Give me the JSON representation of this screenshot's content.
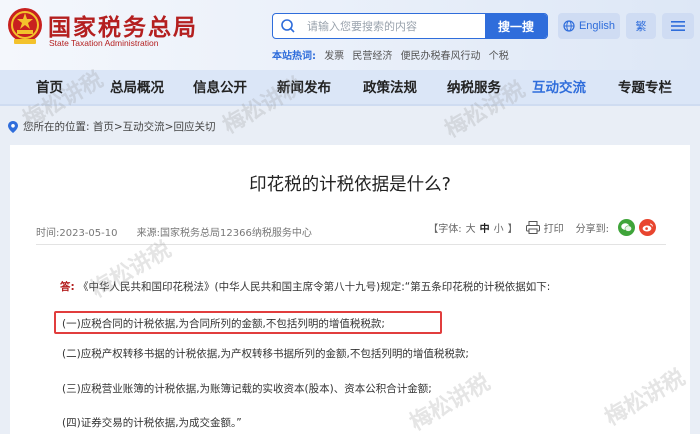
{
  "header": {
    "site_title": "国家税务总局",
    "site_subtitle": "State Taxation Administration",
    "search_placeholder": "请输入您要搜索的内容",
    "search_button": "搜一搜",
    "lang_english": "English",
    "lang_traditional": "繁",
    "hot_label": "本站热词:",
    "hot_words": [
      "发票",
      "民营经济",
      "便民办税春风行动",
      "个税"
    ]
  },
  "nav": {
    "items": [
      "首页",
      "总局概况",
      "信息公开",
      "新闻发布",
      "政策法规",
      "纳税服务",
      "互动交流",
      "专题专栏"
    ],
    "active": "互动交流"
  },
  "breadcrumb": "您所在的位置:  首页>互动交流>回应关切",
  "article": {
    "title": "印花税的计税依据是什么?",
    "time": "时间:2023-05-10",
    "source": "来源:国家税务总局12366纳税服务中心",
    "font_label": "【字体:",
    "font_large": "大",
    "font_medium": "中",
    "font_small": "小",
    "font_end": "】",
    "print": "打印",
    "share": "分享到:",
    "answer_label": "答:",
    "answer_intro": "《中华人民共和国印花税法》(中华人民共和国主席令第八十九号)规定:“第五条印花税的计税依据如下:",
    "items": [
      "(一)应税合同的计税依据,为合同所列的金额,不包括列明的增值税税款;",
      "(二)应税产权转移书据的计税依据,为产权转移书据所列的金额,不包括列明的增值税税款;",
      "(三)应税营业账簿的计税依据,为账簿记载的实收资本(股本)、资本公积合计金额;",
      "(四)证券交易的计税依据,为成交金额。”"
    ]
  },
  "watermark": "梅松讲税",
  "colors": {
    "brand_red": "#b41f1f",
    "accent_blue": "#2f6ddb",
    "highlight_box": "#e13d3d"
  }
}
